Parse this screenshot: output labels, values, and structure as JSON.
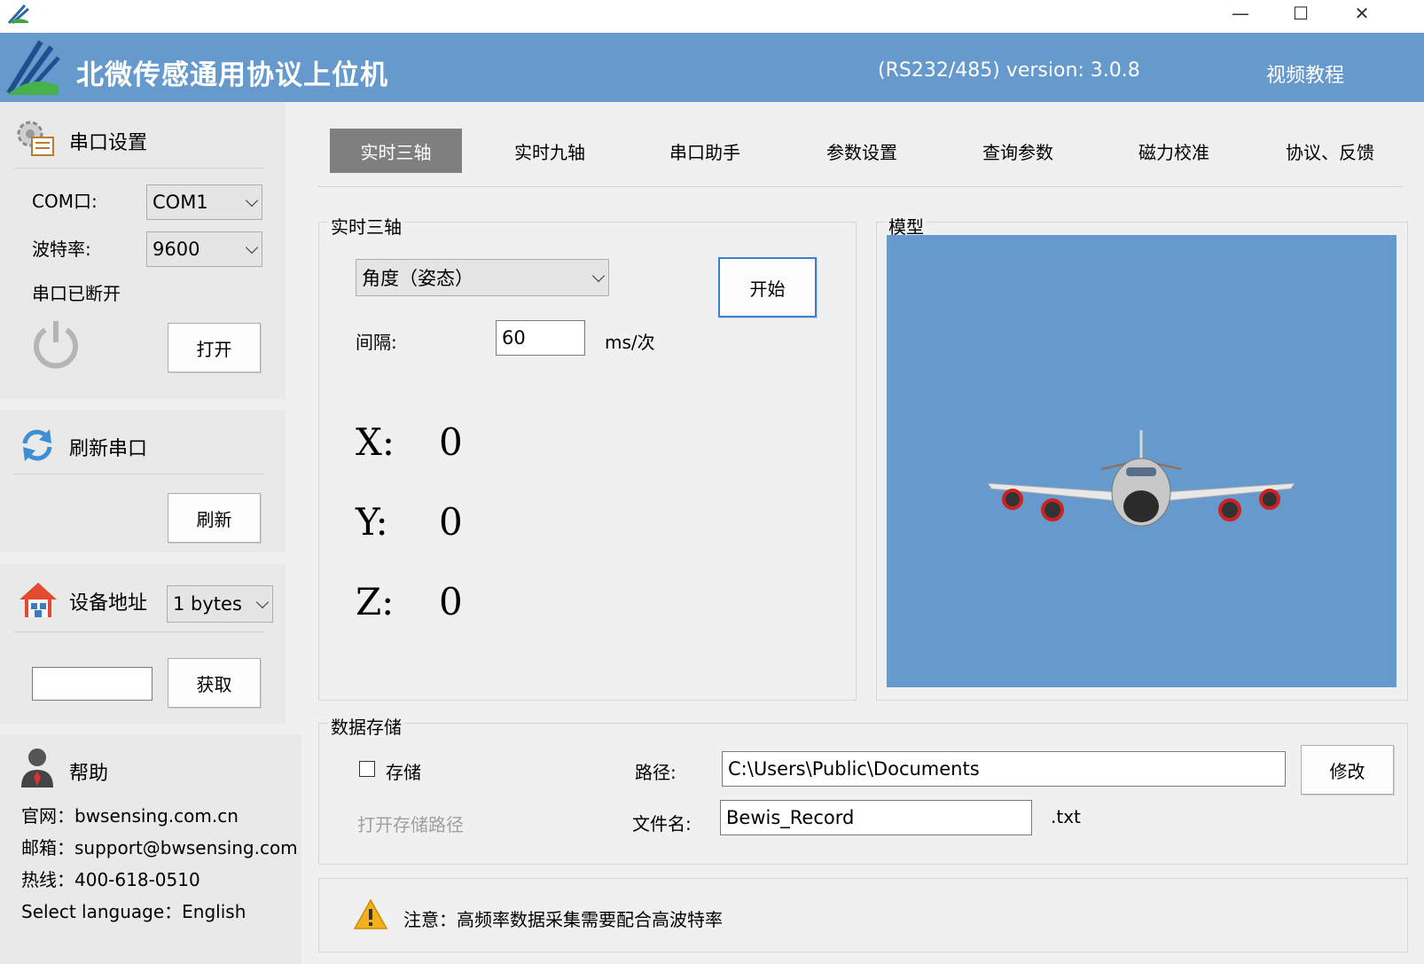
{
  "header": {
    "title": "北微传感通用协议上位机",
    "version": "(RS232/485)  version: 3.0.8",
    "video_link": "视频教程"
  },
  "window_controls": {
    "minimize": "—",
    "maximize": "☐",
    "close": "✕"
  },
  "serial": {
    "title": "串口设置",
    "com_label": "COM口:",
    "com_value": "COM1",
    "baud_label": "波特率:",
    "baud_value": "9600",
    "status": "串口已断开",
    "open_button": "打开"
  },
  "refresh": {
    "title": "刷新串口",
    "button": "刷新"
  },
  "device": {
    "title": "设备地址",
    "bytes_value": "1 bytes",
    "address_value": "",
    "get_button": "获取"
  },
  "help": {
    "title": "帮助",
    "website": "官网：bwsensing.com.cn",
    "email": "邮箱：support@bwsensing.com",
    "hotline": "热线：400-618-0510",
    "language_label": "Select language：",
    "language_value": "English"
  },
  "tabs": [
    "实时三轴",
    "实时九轴",
    "串口助手",
    "参数设置",
    "查询参数",
    "磁力校准",
    "协议、反馈"
  ],
  "realtime": {
    "group_title": "实时三轴",
    "mode_value": "角度（姿态）",
    "start_button": "开始",
    "interval_label": "间隔:",
    "interval_value": "60",
    "interval_unit": "ms/次",
    "x_label": "X:",
    "x_value": "0",
    "y_label": "Y:",
    "y_value": "0",
    "z_label": "Z:",
    "z_value": "0"
  },
  "model": {
    "group_title": "模型",
    "background": "#6699cc"
  },
  "storage": {
    "group_title": "数据存储",
    "store_label": "存储",
    "open_path": "打开存储路径",
    "path_label": "路径:",
    "path_value": "C:\\Users\\Public\\Documents",
    "modify_button": "修改",
    "filename_label": "文件名:",
    "filename_value": "Bewis_Record",
    "extension": ".txt"
  },
  "notice": {
    "text": "注意：高频率数据采集需要配合高波特率"
  },
  "colors": {
    "header": "#6699cc",
    "active_tab": "#7f7f7f",
    "focus_border": "#3c7fd0"
  }
}
